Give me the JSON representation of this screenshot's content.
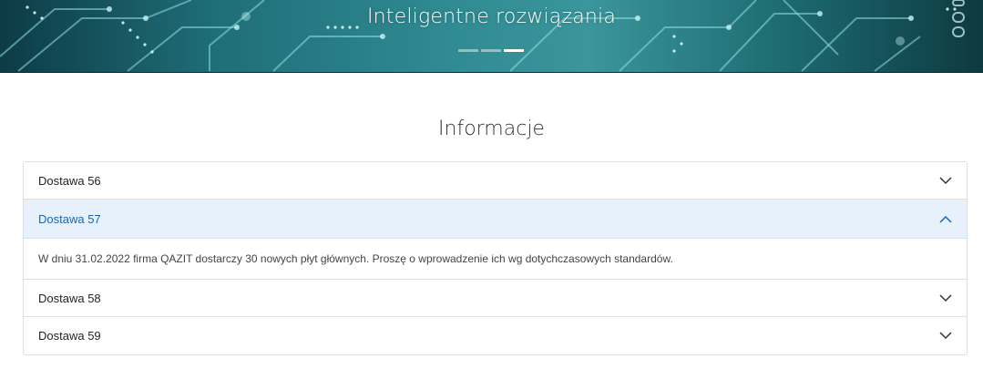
{
  "hero": {
    "title": "Inteligentne rozwiązania",
    "slides": [
      {
        "active": false
      },
      {
        "active": false
      },
      {
        "active": true
      }
    ]
  },
  "section": {
    "title": "Informacje"
  },
  "accordion": {
    "items": [
      {
        "label": "Dostawa 56",
        "expanded": false
      },
      {
        "label": "Dostawa 57",
        "expanded": true,
        "body": "W dniu 31.02.2022 firma QAZIT dostarczy 30 nowych płyt głównych. Proszę o wprowadzenie ich wg dotychczasowych standardów."
      },
      {
        "label": "Dostawa 58",
        "expanded": false
      },
      {
        "label": "Dostawa 59",
        "expanded": false
      }
    ]
  },
  "colors": {
    "hero_teal": "#2f8a92",
    "active_header_bg": "#e7f1fc",
    "active_header_text": "#1b64b7"
  }
}
